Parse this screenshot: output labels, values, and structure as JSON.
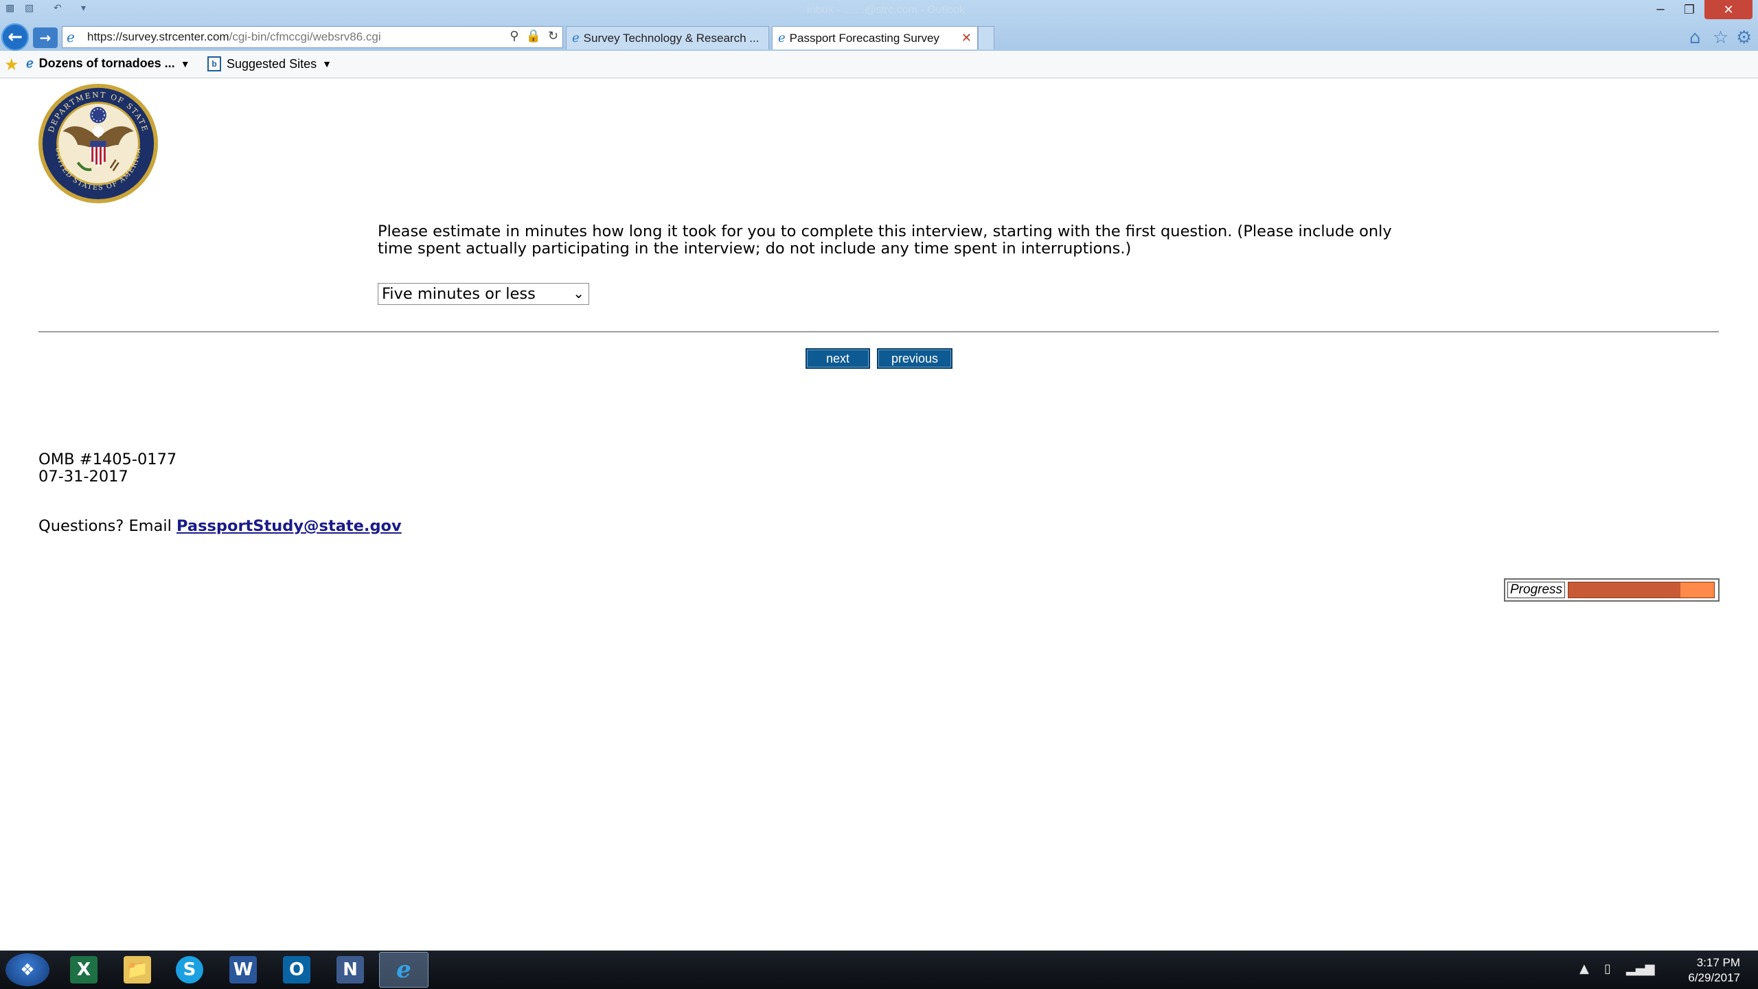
{
  "window": {
    "title": "Inbox - .......@strc.com - Outlook"
  },
  "toolbar": {
    "min_icon": "minimize-icon",
    "max_icon": "restore-icon",
    "close_icon": "close-icon"
  },
  "addressbar": {
    "url_host": "https://survey.strcenter.com",
    "url_path": "/cgi-bin/cfmccgi/websrv86.cgi"
  },
  "tabs": [
    {
      "label": "Survey Technology & Research ..."
    },
    {
      "label": "Passport Forecasting Survey",
      "active": true
    }
  ],
  "favorites": {
    "item1": "Dozens of tornadoes ...",
    "item2": "Suggested Sites"
  },
  "page": {
    "question": "Please estimate in minutes how long it took for you to complete this interview, starting with the first question. (Please include only time spent actually participating in the interview; do not include any time spent in interruptions.)",
    "answer_selected": "Five minutes or less",
    "next_label": "next",
    "previous_label": "previous",
    "omb_number": "OMB #1405-0177",
    "omb_date": "07-31-2017",
    "questions_prefix": "Questions? Email ",
    "questions_email": "PassportStudy@state.gov",
    "progress_label": "Progress",
    "progress_fraction": 0.77,
    "seal_alt_top": "DEPARTMENT OF STATE",
    "seal_alt_bottom": "UNITED STATES OF AMERICA"
  },
  "colors": {
    "button_bg": "#0e5a92",
    "progress_fill": "#c95a38",
    "progress_track": "#ff8a4a",
    "link": "#1a1a8a"
  },
  "taskbar": {
    "apps": [
      "excel-icon",
      "file-explorer-icon",
      "skype-icon",
      "word-icon",
      "outlook-icon",
      "nuance-icon",
      "internet-explorer-icon"
    ],
    "time": "3:17 PM",
    "date": "6/29/2017"
  }
}
